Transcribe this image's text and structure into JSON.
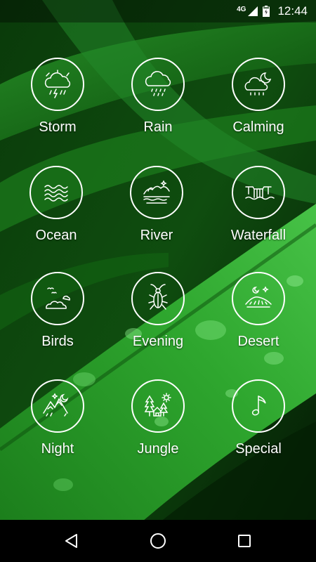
{
  "status_bar": {
    "network": "4G",
    "time": "12:44"
  },
  "tiles": [
    {
      "label": "Storm",
      "icon": "storm-cloud-icon"
    },
    {
      "label": "Rain",
      "icon": "rain-cloud-icon"
    },
    {
      "label": "Calming",
      "icon": "moon-cloud-icon"
    },
    {
      "label": "Ocean",
      "icon": "waves-icon"
    },
    {
      "label": "River",
      "icon": "river-icon"
    },
    {
      "label": "Waterfall",
      "icon": "waterfall-icon"
    },
    {
      "label": "Birds",
      "icon": "birds-icon"
    },
    {
      "label": "Evening",
      "icon": "cricket-icon"
    },
    {
      "label": "Desert",
      "icon": "desert-icon"
    },
    {
      "label": "Night",
      "icon": "night-mountains-icon"
    },
    {
      "label": "Jungle",
      "icon": "jungle-icon"
    },
    {
      "label": "Special",
      "icon": "music-note-icon"
    }
  ],
  "nav_bar": {
    "buttons": [
      "back-icon",
      "home-icon",
      "recents-icon"
    ]
  },
  "colors": {
    "background_green": "#1e8a1e",
    "dark_green": "#062806",
    "icon_stroke": "#ffffff"
  }
}
